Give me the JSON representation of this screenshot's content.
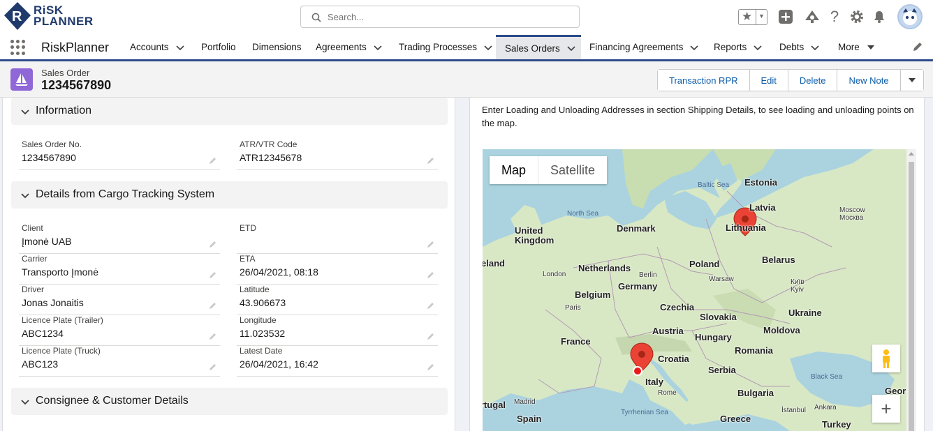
{
  "brand": {
    "line1": "RiSK",
    "line2": "PLANNER"
  },
  "search": {
    "placeholder": "Search..."
  },
  "nav": {
    "app_name": "RiskPlanner",
    "items": [
      {
        "label": "Accounts",
        "has_menu": true
      },
      {
        "label": "Portfolio",
        "has_menu": false
      },
      {
        "label": "Dimensions",
        "has_menu": false
      },
      {
        "label": "Agreements",
        "has_menu": true
      },
      {
        "label": "Trading Processes",
        "has_menu": true
      },
      {
        "label": "Sales Orders",
        "has_menu": true,
        "active": true
      },
      {
        "label": "Financing Agreements",
        "has_menu": true
      },
      {
        "label": "Reports",
        "has_menu": true
      },
      {
        "label": "Debts",
        "has_menu": true
      },
      {
        "label": "More",
        "has_menu": true
      }
    ]
  },
  "record": {
    "type": "Sales Order",
    "name": "1234567890",
    "actions": [
      "Transaction RPR",
      "Edit",
      "Delete",
      "New Note"
    ]
  },
  "sections": {
    "information": "Information",
    "cargo": "Details from Cargo Tracking System",
    "consignee": "Consignee & Customer Details"
  },
  "information_fields": [
    {
      "label": "Sales Order No.",
      "value": "1234567890"
    },
    {
      "label": "ATR/VTR Code",
      "value": "ATR12345678"
    }
  ],
  "cargo_fields": [
    {
      "label": "Client",
      "value": "Įmonė UAB"
    },
    {
      "label": "ETD",
      "value": ""
    },
    {
      "label": "Carrier",
      "value": "Transporto Įmonė"
    },
    {
      "label": "ETA",
      "value": "26/04/2021, 08:18"
    },
    {
      "label": "Driver",
      "value": "Jonas Jonaitis"
    },
    {
      "label": "Latitude",
      "value": "43.906673"
    },
    {
      "label": "Licence Plate (Trailer)",
      "value": "ABC1234"
    },
    {
      "label": "Longitude",
      "value": "11.023532"
    },
    {
      "label": "Licence Plate (Truck)",
      "value": "ABC123"
    },
    {
      "label": "Latest Date",
      "value": "26/04/2021, 16:42"
    }
  ],
  "map": {
    "hint": "Enter Loading and Unloading Addresses in section Shipping Details, to see loading and unloading points on the map.",
    "toggle_map": "Map",
    "toggle_satellite": "Satellite",
    "zoom_in": "+",
    "labels": {
      "estonia": "Estonia",
      "latvia": "Latvia",
      "lithuania": "Lithuania",
      "denmark": "Denmark",
      "uk": "United Kingdom",
      "ireland": "Ireland",
      "netherlands": "Netherlands",
      "poland": "Poland",
      "belarus": "Belarus",
      "germany": "Germany",
      "belgium": "Belgium",
      "czechia": "Czechia",
      "slovakia": "Slovakia",
      "ukraine": "Ukraine",
      "moldova": "Moldova",
      "austria": "Austria",
      "hungary": "Hungary",
      "france": "France",
      "romania": "Romania",
      "croatia": "Croatia",
      "serbia": "Serbia",
      "italy": "Italy",
      "bulgaria": "Bulgaria",
      "portugal": "Portugal",
      "spain": "Spain",
      "greece": "Greece",
      "turkey": "Turkey",
      "georgia": "Geor",
      "london": "London",
      "berlin": "Berlin",
      "warsaw": "Warsaw",
      "kyiv": "Київ\nKyiv",
      "moscow": "Moscow\nМосква",
      "paris": "Paris",
      "rome": "Rome",
      "madrid": "Madrid",
      "ankara": "Ankara",
      "istanbul": "İstanbul",
      "north_sea": "North Sea",
      "baltic_sea": "Baltic Sea",
      "black_sea": "Black Sea",
      "tyrrhenian": "Tyrrhenian Sea"
    }
  }
}
